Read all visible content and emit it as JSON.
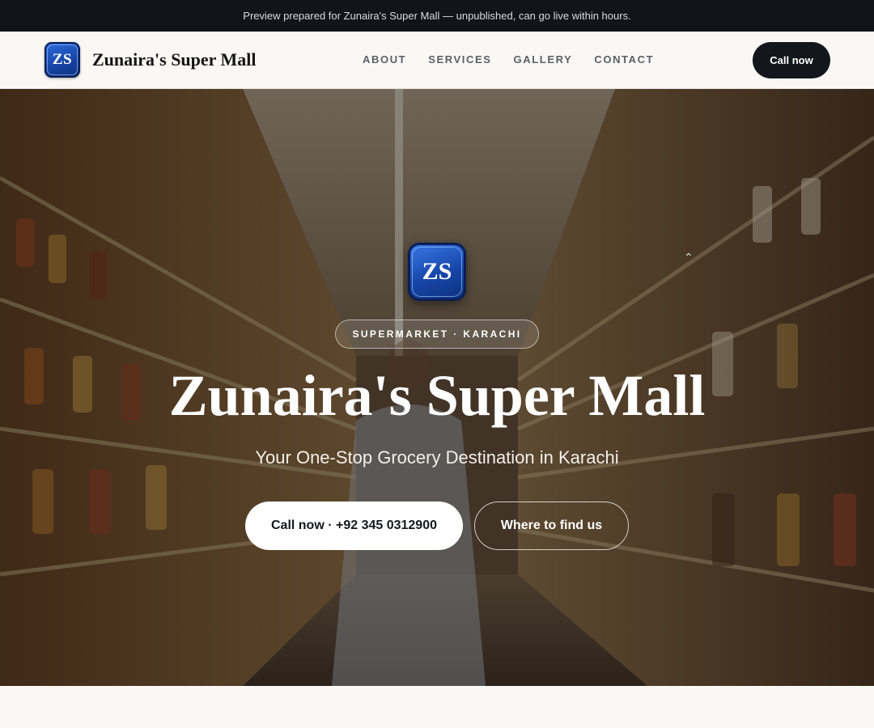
{
  "preview_banner": {
    "text": "Preview prepared for Zunaira's Super Mall — unpublished, can go live within hours."
  },
  "header": {
    "logo_initials": "ZS",
    "brand_name": "Zunaira's Super Mall",
    "nav": [
      {
        "label": "ABOUT"
      },
      {
        "label": "SERVICES"
      },
      {
        "label": "GALLERY"
      },
      {
        "label": "CONTACT"
      }
    ],
    "cta_label": "Call now"
  },
  "hero": {
    "logo_initials": "ZS",
    "chip": "SUPERMARKET · KARACHI",
    "title": "Zunaira's Super Mall",
    "subtitle": "Your One-Stop Grocery Destination in Karachi",
    "primary_button": "Call now · +92 345 0312900",
    "secondary_button": "Where to find us",
    "background_image": "supermarket-aisle-photo"
  },
  "colors": {
    "top_bar": "#111419",
    "header_bg": "#f9f8f5",
    "cta_dark": "#13161c",
    "logo_blue": "#1746a8"
  }
}
